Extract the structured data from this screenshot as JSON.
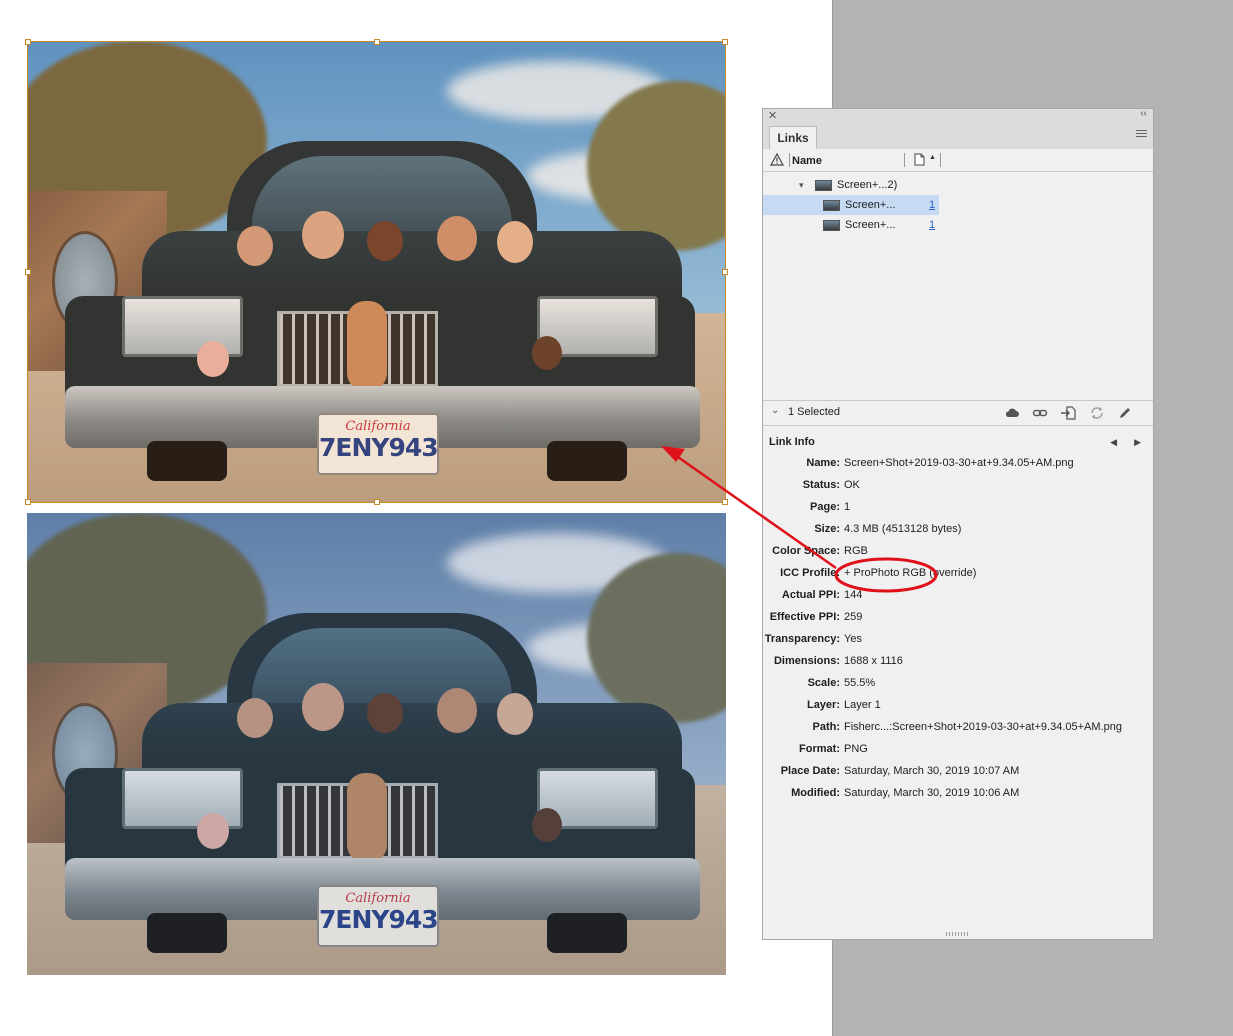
{
  "links_panel": {
    "tab_label": "Links",
    "column_name_label": "Name",
    "links": [
      {
        "name": "Screen+...2)",
        "page": "",
        "kind": "parent"
      },
      {
        "name": "Screen+...",
        "page": "1",
        "kind": "child",
        "selected": true
      },
      {
        "name": "Screen+...",
        "page": "1",
        "kind": "child",
        "selected": false
      }
    ],
    "selected_count_text": "1 Selected",
    "toolbar_icons": [
      "cloud-relink-icon",
      "relink-icon",
      "go-to-link-icon",
      "update-link-icon",
      "edit-original-icon"
    ],
    "link_info_title": "Link Info",
    "link_info": [
      {
        "label": "Name:",
        "value": "Screen+Shot+2019-03-30+at+9.34.05+AM.png"
      },
      {
        "label": "Status:",
        "value": "OK"
      },
      {
        "label": "Page:",
        "value": "1"
      },
      {
        "label": "Size:",
        "value": "4.3 MB (4513128 bytes)"
      },
      {
        "label": "Color Space:",
        "value": "RGB"
      },
      {
        "label": "ICC Profile:",
        "value": "+ ProPhoto RGB (override)"
      },
      {
        "label": "Actual PPI:",
        "value": "144"
      },
      {
        "label": "Effective PPI:",
        "value": "259"
      },
      {
        "label": "Transparency:",
        "value": "Yes"
      },
      {
        "label": "Dimensions:",
        "value": "1688 x 1116"
      },
      {
        "label": "Scale:",
        "value": "55.5%"
      },
      {
        "label": "Layer:",
        "value": "Layer 1"
      },
      {
        "label": "Path:",
        "value": "Fisherc...:Screen+Shot+2019-03-30+at+9.34.05+AM.png"
      },
      {
        "label": "Format:",
        "value": "PNG"
      },
      {
        "label": "Place Date:",
        "value": "Saturday, March 30, 2019 10:07 AM"
      },
      {
        "label": "Modified:",
        "value": "Saturday, March 30, 2019 10:06 AM"
      }
    ]
  },
  "photos": {
    "plate_state": "California",
    "plate_number": "7ENY943"
  },
  "colors": {
    "selection_frame": "#c78a2b",
    "annotation": "#e0101a",
    "selected_row": "#c6daf3",
    "link_blue": "#2a62c9"
  }
}
